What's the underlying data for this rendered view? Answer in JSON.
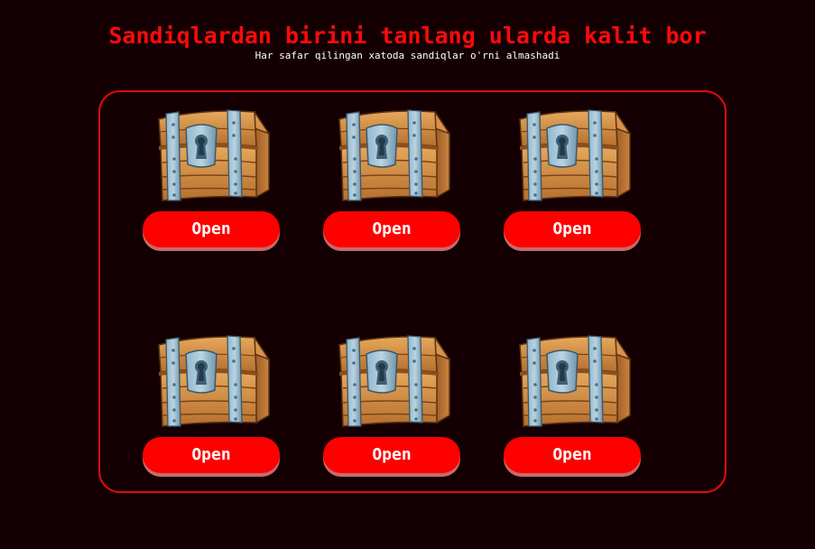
{
  "header": {
    "title": "Sandiqlardan birini tanlang ularda kalit bor",
    "subtitle": "Har safar qilingan xatoda sandiqlar o'rni almashadi"
  },
  "chests": [
    {
      "icon": "treasure-chest-icon",
      "button_label": "Open"
    },
    {
      "icon": "treasure-chest-icon",
      "button_label": "Open"
    },
    {
      "icon": "treasure-chest-icon",
      "button_label": "Open"
    },
    {
      "icon": "treasure-chest-icon",
      "button_label": "Open"
    },
    {
      "icon": "treasure-chest-icon",
      "button_label": "Open"
    },
    {
      "icon": "treasure-chest-icon",
      "button_label": "Open"
    }
  ],
  "colors": {
    "background": "#140003",
    "accent": "#ff0000",
    "title": "#ff0a0a",
    "board_border": "#e00a0a",
    "button_text": "#ffffff"
  }
}
